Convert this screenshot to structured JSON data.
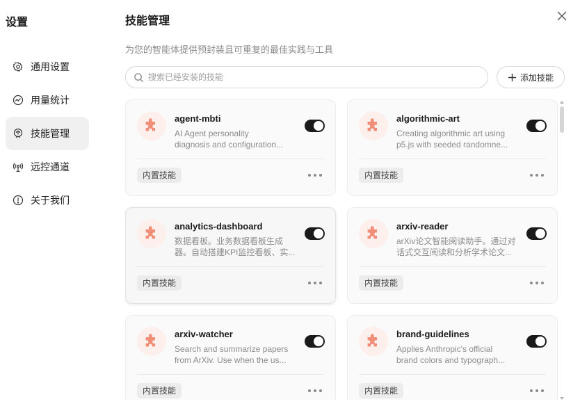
{
  "sidebar": {
    "title": "设置",
    "items": [
      {
        "label": "通用设置",
        "icon": "gear-icon",
        "active": false
      },
      {
        "label": "用量统计",
        "icon": "chart-icon",
        "active": false
      },
      {
        "label": "技能管理",
        "icon": "brain-icon",
        "active": true
      },
      {
        "label": "远控通道",
        "icon": "broadcast-icon",
        "active": false
      },
      {
        "label": "关于我们",
        "icon": "info-icon",
        "active": false
      }
    ]
  },
  "header": {
    "title": "技能管理",
    "subtitle": "为您的智能体提供预封装且可重复的最佳实践与工具"
  },
  "search": {
    "placeholder": "搜索已经安装的技能",
    "value": ""
  },
  "add_button": {
    "label": "添加技能"
  },
  "skills": [
    {
      "name": "agent-mbti",
      "desc_line1": "AI Agent personality",
      "desc_line2": "diagnosis and configuration...",
      "badge": "内置技能",
      "enabled": true
    },
    {
      "name": "algorithmic-art",
      "desc_line1": "Creating algorithmic art using",
      "desc_line2": "p5.js with seeded randomne...",
      "badge": "内置技能",
      "enabled": true
    },
    {
      "name": "analytics-dashboard",
      "desc_line1": "数据看板。业务数据看板生成",
      "desc_line2": "器。自动搭建KPI监控看板、实...",
      "badge": "内置技能",
      "enabled": true
    },
    {
      "name": "arxiv-reader",
      "desc_line1": "arXiv论文智能阅读助手。通过对",
      "desc_line2": "话式交互阅读和分析学术论文...",
      "badge": "内置技能",
      "enabled": true
    },
    {
      "name": "arxiv-watcher",
      "desc_line1": "Search and summarize papers",
      "desc_line2": "from ArXiv. Use when the us...",
      "badge": "内置技能",
      "enabled": true
    },
    {
      "name": "brand-guidelines",
      "desc_line1": "Applies Anthropic's official",
      "desc_line2": "brand colors and typograph...",
      "badge": "内置技能",
      "enabled": true
    }
  ],
  "colors": {
    "accent": "#1a1a1a",
    "skill_icon": "#f0836a",
    "skill_icon_bg": "#fdf0ec"
  }
}
